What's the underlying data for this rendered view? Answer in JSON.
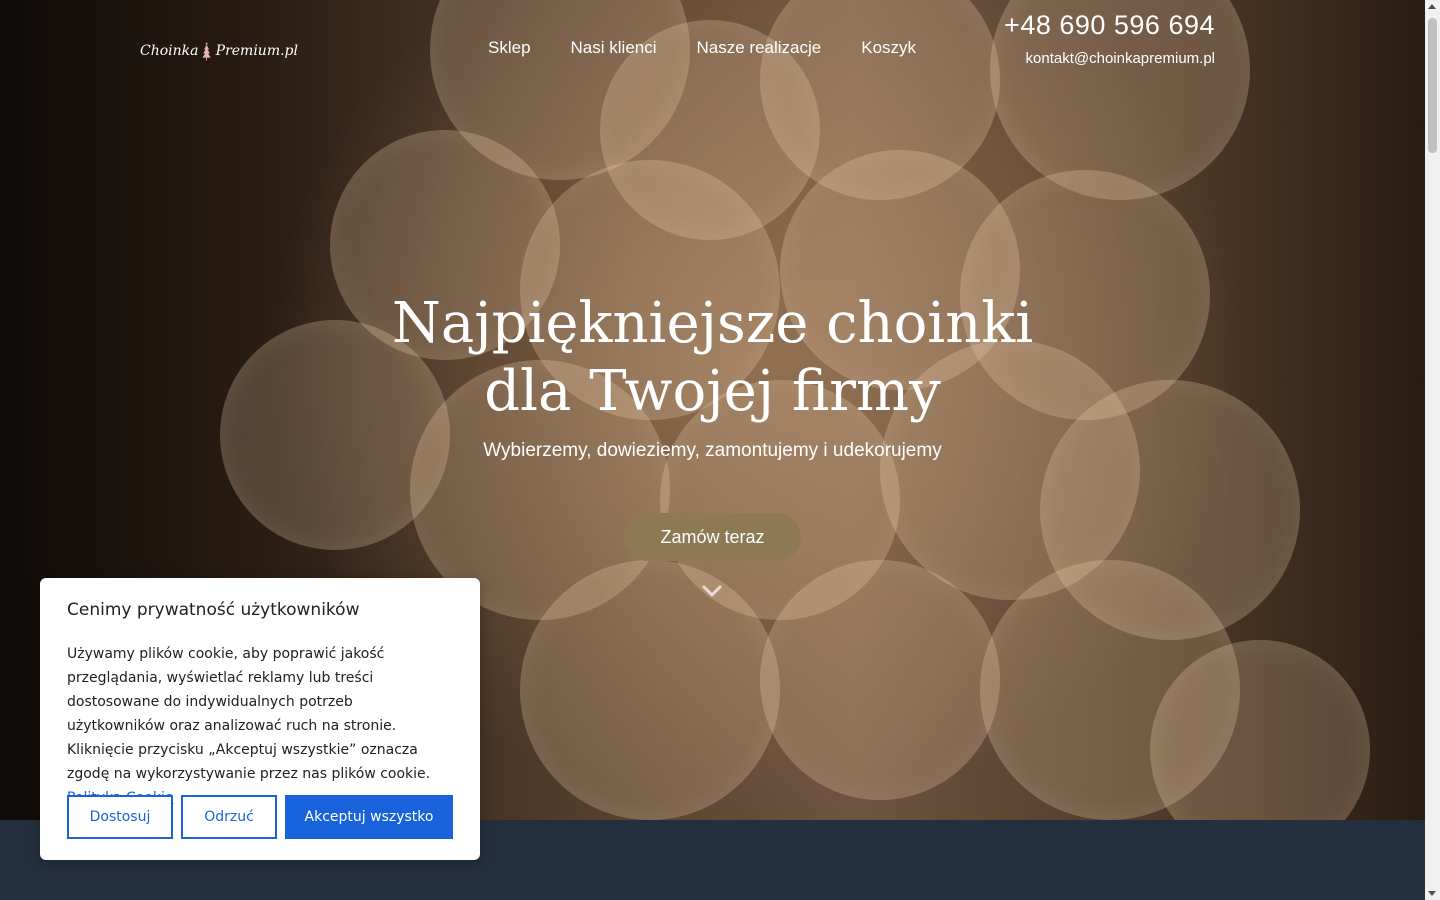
{
  "header": {
    "logo_left": "Choinka",
    "logo_right": "Premium.pl",
    "nav": [
      "Sklep",
      "Nasi klienci",
      "Nasze realizacje",
      "Koszyk"
    ],
    "phone": "+48 690 596 694",
    "email": "kontakt@choinkapremium.pl"
  },
  "hero": {
    "title_line1": "Najpiękniejsze choinki",
    "title_line2": "dla Twojej firmy",
    "subtitle": "Wybierzemy, dowieziemy, zamontujemy i udekorujemy",
    "cta_label": "Zamów teraz"
  },
  "cookie": {
    "title": "Cenimy prywatność użytkowników",
    "text": "Używamy plików cookie, aby poprawić jakość przeglądania, wyświetlać reklamy lub treści dostosowane do indywidualnych potrzeb użytkowników oraz analizować ruch na stronie. Kliknięcie przycisku „Akceptuj wszystkie” oznacza zgodę na wykorzystywanie przez nas plików cookie.",
    "link_label": "Polityka Cookie",
    "btn_customize": "Dostosuj",
    "btn_reject": "Odrzuć",
    "btn_accept": "Akceptuj wszystko"
  },
  "colors": {
    "cta_bg": "#8d7a55",
    "cookie_accent": "#1863dc",
    "bottom_band": "#232f3e"
  },
  "icons": {
    "logo_tree": "christmas-tree-icon",
    "scroll_down": "chevron-down-icon"
  }
}
